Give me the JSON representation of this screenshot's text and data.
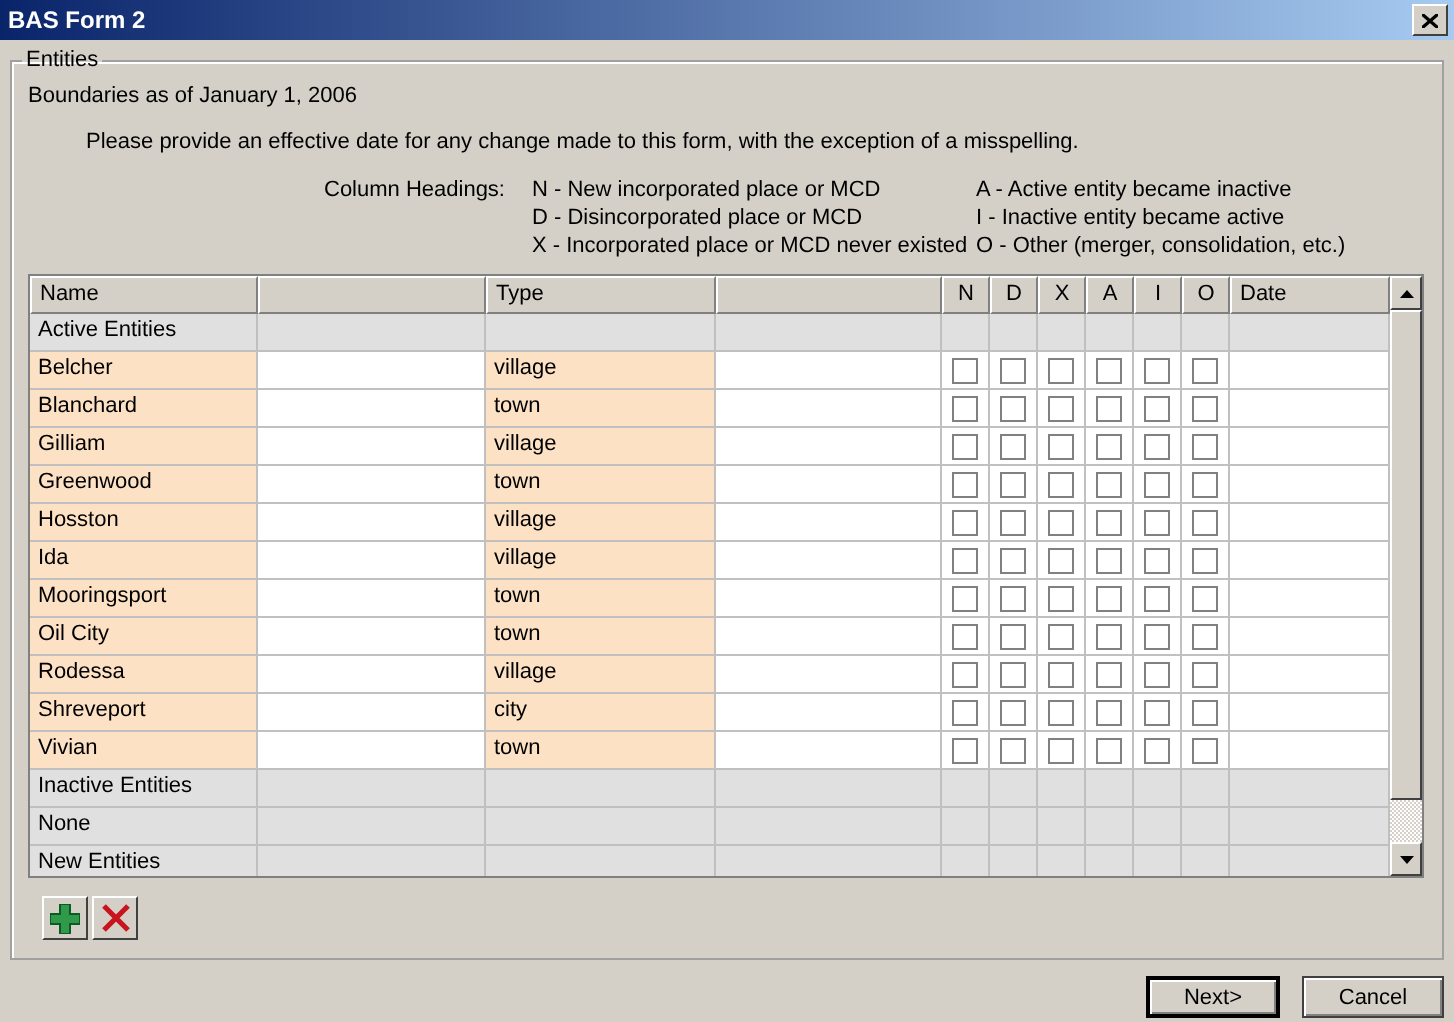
{
  "window": {
    "title": "BAS Form 2"
  },
  "group": {
    "title": "Entities"
  },
  "boundaries": "Boundaries as of January 1, 2006",
  "instruction": "Please provide an effective date for any change made to this form, with the exception of a misspelling.",
  "legend": {
    "label": "Column Headings:",
    "left": [
      "N - New incorporated place or MCD",
      "D - Disincorporated place or MCD",
      "X - Incorporated place or MCD never existed"
    ],
    "right": [
      "A - Active entity became inactive",
      "I - Inactive entity became active",
      "O - Other (merger, consolidation, etc.)"
    ]
  },
  "table": {
    "columns": [
      {
        "kind": "text",
        "label": "Name"
      },
      {
        "kind": "blank"
      },
      {
        "kind": "text",
        "label": "Type"
      },
      {
        "kind": "blank"
      },
      {
        "kind": "flag",
        "label": "N"
      },
      {
        "kind": "flag",
        "label": "D"
      },
      {
        "kind": "flag",
        "label": "X"
      },
      {
        "kind": "flag",
        "label": "A"
      },
      {
        "kind": "flag",
        "label": "I"
      },
      {
        "kind": "flag",
        "label": "O"
      },
      {
        "kind": "text",
        "label": "Date"
      }
    ],
    "rows": [
      {
        "kind": "section",
        "label": "Active Entities"
      },
      {
        "kind": "entity",
        "name": "Belcher",
        "type": "village",
        "flags": [
          false,
          false,
          false,
          false,
          false,
          false
        ]
      },
      {
        "kind": "entity",
        "name": "Blanchard",
        "type": "town",
        "flags": [
          false,
          false,
          false,
          false,
          false,
          false
        ]
      },
      {
        "kind": "entity",
        "name": "Gilliam",
        "type": "village",
        "flags": [
          false,
          false,
          false,
          false,
          false,
          false
        ]
      },
      {
        "kind": "entity",
        "name": "Greenwood",
        "type": "town",
        "flags": [
          false,
          false,
          false,
          false,
          false,
          false
        ]
      },
      {
        "kind": "entity",
        "name": "Hosston",
        "type": "village",
        "flags": [
          false,
          false,
          false,
          false,
          false,
          false
        ]
      },
      {
        "kind": "entity",
        "name": "Ida",
        "type": "village",
        "flags": [
          false,
          false,
          false,
          false,
          false,
          false
        ]
      },
      {
        "kind": "entity",
        "name": "Mooringsport",
        "type": "town",
        "flags": [
          false,
          false,
          false,
          false,
          false,
          false
        ]
      },
      {
        "kind": "entity",
        "name": "Oil City",
        "type": "town",
        "flags": [
          false,
          false,
          false,
          false,
          false,
          false
        ]
      },
      {
        "kind": "entity",
        "name": "Rodessa",
        "type": "village",
        "flags": [
          false,
          false,
          false,
          false,
          false,
          false
        ]
      },
      {
        "kind": "entity",
        "name": "Shreveport",
        "type": "city",
        "flags": [
          false,
          false,
          false,
          false,
          false,
          false
        ]
      },
      {
        "kind": "entity",
        "name": "Vivian",
        "type": "town",
        "flags": [
          false,
          false,
          false,
          false,
          false,
          false
        ]
      },
      {
        "kind": "section",
        "label": "Inactive Entities"
      },
      {
        "kind": "section",
        "label": "None"
      },
      {
        "kind": "section",
        "label": "New Entities"
      }
    ]
  },
  "buttons": [
    {
      "kind": "default",
      "label": "Next>"
    },
    {
      "kind": "normal",
      "label": "Cancel"
    }
  ]
}
